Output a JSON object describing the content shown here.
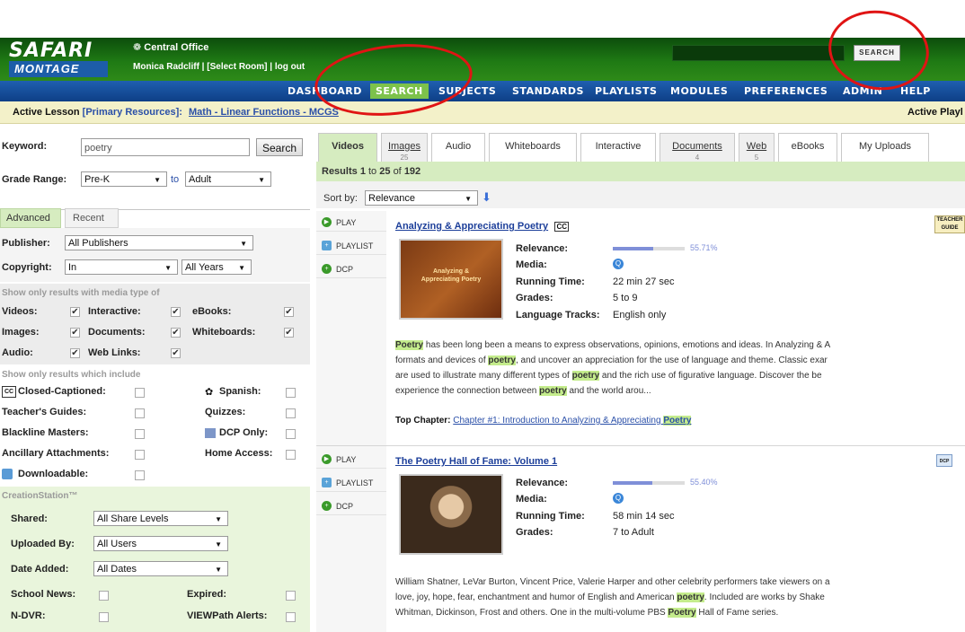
{
  "header": {
    "logo_top": "SAFARI",
    "logo_bottom": "MONTAGE",
    "district": "Central Office",
    "user_line": "Monica Radcliff | [Select Room] | log out",
    "search_button": "SEARCH"
  },
  "nav": {
    "items": [
      {
        "label": "DASHBOARD"
      },
      {
        "label": "SEARCH"
      },
      {
        "label": "SUBJECTS"
      },
      {
        "label": "STANDARDS"
      },
      {
        "label": "PLAYLISTS"
      },
      {
        "label": "MODULES"
      },
      {
        "label": "PREFERENCES"
      },
      {
        "label": "ADMIN"
      },
      {
        "label": "HELP"
      }
    ],
    "active": "SEARCH"
  },
  "lesson_bar": {
    "prefix": "Active Lesson",
    "resources": "[Primary Resources]:",
    "lesson": "Math - Linear Functions - MCGS",
    "right": "Active Playl"
  },
  "filters": {
    "keyword_label": "Keyword:",
    "keyword_value": "poetry",
    "search_button": "Search",
    "grade_label": "Grade Range:",
    "grade_from": "Pre-K",
    "grade_to_label": "to",
    "grade_to": "Adult",
    "tabs": [
      "Advanced",
      "Recent"
    ],
    "publisher_label": "Publisher:",
    "publisher_value": "All Publishers",
    "copyright_label": "Copyright:",
    "copyright_value": "In",
    "years_value": "All Years",
    "media_head": "Show only results with media type of",
    "media": [
      {
        "label": "Videos:",
        "checked": true
      },
      {
        "label": "Interactive:",
        "checked": true
      },
      {
        "label": "eBooks:",
        "checked": true
      },
      {
        "label": "Images:",
        "checked": true
      },
      {
        "label": "Documents:",
        "checked": true
      },
      {
        "label": "Whiteboards:",
        "checked": true
      },
      {
        "label": "Audio:",
        "checked": true
      },
      {
        "label": "Web Links:",
        "checked": true
      }
    ],
    "include_head": "Show only results which include",
    "include": {
      "closed_captioned": "Closed-Captioned:",
      "spanish": "Spanish:",
      "teachers_guides": "Teacher's Guides:",
      "quizzes": "Quizzes:",
      "blackline": "Blackline Masters:",
      "dcp_only": "DCP Only:",
      "ancillary": "Ancillary Attachments:",
      "home_access": "Home Access:",
      "downloadable": "Downloadable:"
    },
    "creation_head": "CreationStation™",
    "shared_label": "Shared:",
    "shared_value": "All Share Levels",
    "uploaded_label": "Uploaded By:",
    "uploaded_value": "All Users",
    "date_label": "Date Added:",
    "date_value": "All Dates",
    "school_news": "School News:",
    "expired": "Expired:",
    "ndvr": "N-DVR:",
    "viewpath": "VIEWPath Alerts:"
  },
  "results": {
    "tabs": [
      {
        "label": "Videos",
        "count": ""
      },
      {
        "label": "Images",
        "count": "25"
      },
      {
        "label": "Audio",
        "count": ""
      },
      {
        "label": "Whiteboards",
        "count": ""
      },
      {
        "label": "Interactive",
        "count": ""
      },
      {
        "label": "Documents",
        "count": "4"
      },
      {
        "label": "Web",
        "count": "5"
      },
      {
        "label": "eBooks",
        "count": ""
      },
      {
        "label": "My Uploads",
        "count": ""
      }
    ],
    "summary": {
      "prefix": "Results",
      "from": "1",
      "to_word": "to",
      "to": "25",
      "of_word": "of",
      "total": "192"
    },
    "sort_label": "Sort by:",
    "sort_value": "Relevance",
    "actions": [
      "PLAY",
      "PLAYLIST",
      "DCP"
    ],
    "meta_labels": {
      "relevance": "Relevance:",
      "media": "Media:",
      "running": "Running Time:",
      "grades": "Grades:",
      "language": "Language Tracks:"
    },
    "items": [
      {
        "title": "Analyzing & Appreciating Poetry",
        "cc": "CC",
        "thumb_text": "Analyzing & Appreciating Poetry",
        "relevance_text": "55.71%",
        "relevance": 55.71,
        "running_time": "22 min 27 sec",
        "grades": "5 to 9",
        "language": "English only",
        "desc": [
          {
            "w": "Poetry",
            "r": " has been long been a means to express observations, opinions, emotions and ideas. In Analyzing & A"
          },
          {
            "a": "formats and devices of ",
            "w": "poetry",
            "r": ", and uncover an appreciation for the use of language and theme. Classic exar"
          },
          {
            "a": "are used to illustrate many different types of ",
            "w": "poetry",
            "r": " and the rich use of figurative language. Discover the be"
          },
          {
            "a": "experience the connection between ",
            "w": "poetry",
            "r": " and the world arou..."
          }
        ],
        "top_chapter_label": "Top Chapter:",
        "top_chapter_link": "Chapter #1: Introduction to Analyzing & Appreciating",
        "top_chapter_word": "Poetry"
      },
      {
        "title": "The Poetry Hall of Fame: Volume 1",
        "relevance_text": "55.40%",
        "relevance": 55.4,
        "running_time": "58 min 14 sec",
        "grades": "7 to Adult",
        "desc": [
          {
            "a": "William Shatner, LeVar Burton, Vincent Price, Valerie Harper and other celebrity performers take viewers on a"
          },
          {
            "a": "love, joy, hope, fear, enchantment and humor of English and American ",
            "w": "poetry",
            "r": ". Included are works by Shake"
          },
          {
            "a": "Whitman, Dickinson, Frost and others. One in the multi-volume PBS ",
            "w": "Poetry",
            "r": " Hall of Fame series."
          }
        ]
      }
    ],
    "badge1": "TEACHER GUIDE",
    "badge2": "DCP"
  }
}
